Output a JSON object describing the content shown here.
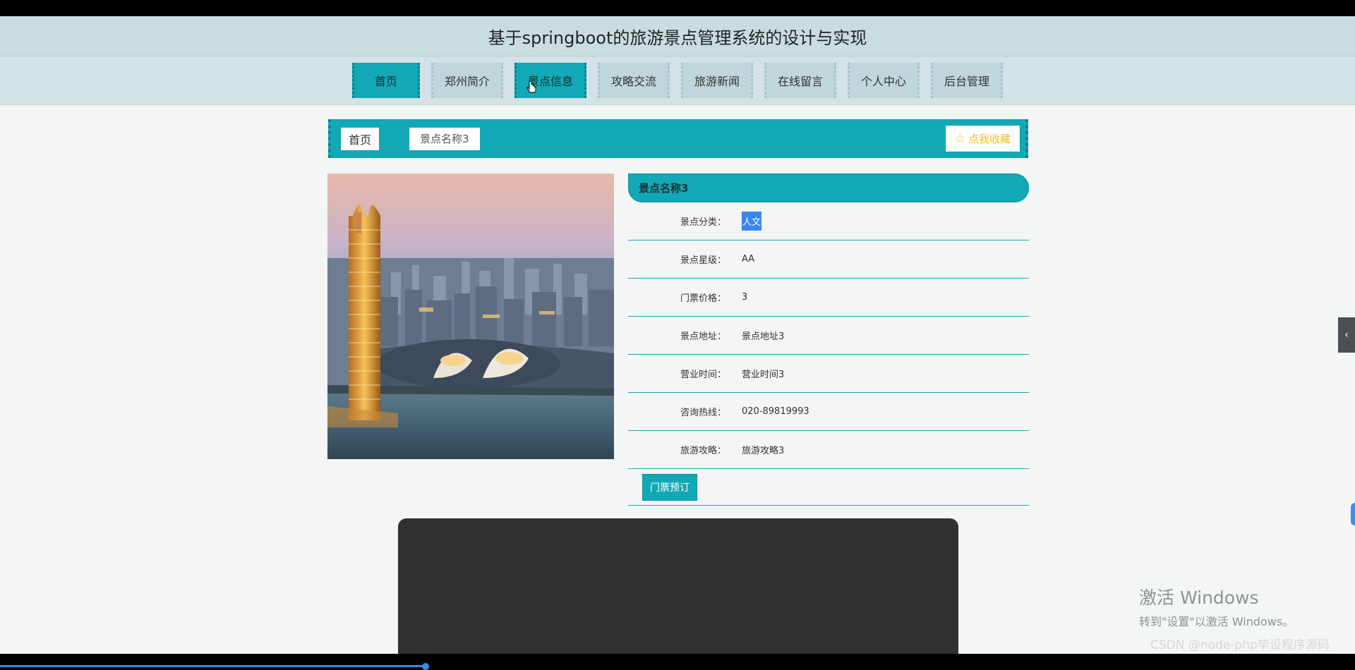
{
  "header": {
    "title": "基于springboot的旅游景点管理系统的设计与实现"
  },
  "nav": [
    {
      "label": "首页",
      "state": "active"
    },
    {
      "label": "郑州简介",
      "state": ""
    },
    {
      "label": "景点信息",
      "state": "hover"
    },
    {
      "label": "攻略交流",
      "state": ""
    },
    {
      "label": "旅游新闻",
      "state": ""
    },
    {
      "label": "在线留言",
      "state": ""
    },
    {
      "label": "个人中心",
      "state": ""
    },
    {
      "label": "后台管理",
      "state": ""
    }
  ],
  "breadcrumb": {
    "home": "首页",
    "current": "景点名称3"
  },
  "favorite_button": {
    "label": "点我收藏",
    "icon": "star-outline-icon"
  },
  "detail": {
    "title": "景点名称3",
    "rows": [
      {
        "label": "景点分类：",
        "value": "人文"
      },
      {
        "label": "景点星级：",
        "value": "AA"
      },
      {
        "label": "门票价格：",
        "value": "3"
      },
      {
        "label": "景点地址：",
        "value": "景点地址3"
      },
      {
        "label": "营业时间：",
        "value": "营业时间3"
      },
      {
        "label": "咨询热线：",
        "value": "020-89819993"
      },
      {
        "label": "旅游攻略：",
        "value": "旅游攻略3"
      }
    ],
    "book_button": "门票预订"
  },
  "side_toggle": "‹",
  "watermark": {
    "line1": "激活 Windows",
    "line2": "转到\"设置\"以激活 Windows。"
  },
  "csdn": "CSDN @node-php毕设程序源码",
  "colors": {
    "accent": "#12a8b5",
    "header_bg": "#c9dde1",
    "nav_bg": "#d2e2e6",
    "favorite": "#f2c01e",
    "selection": "#3a86f1"
  },
  "video_progress": 0.315
}
